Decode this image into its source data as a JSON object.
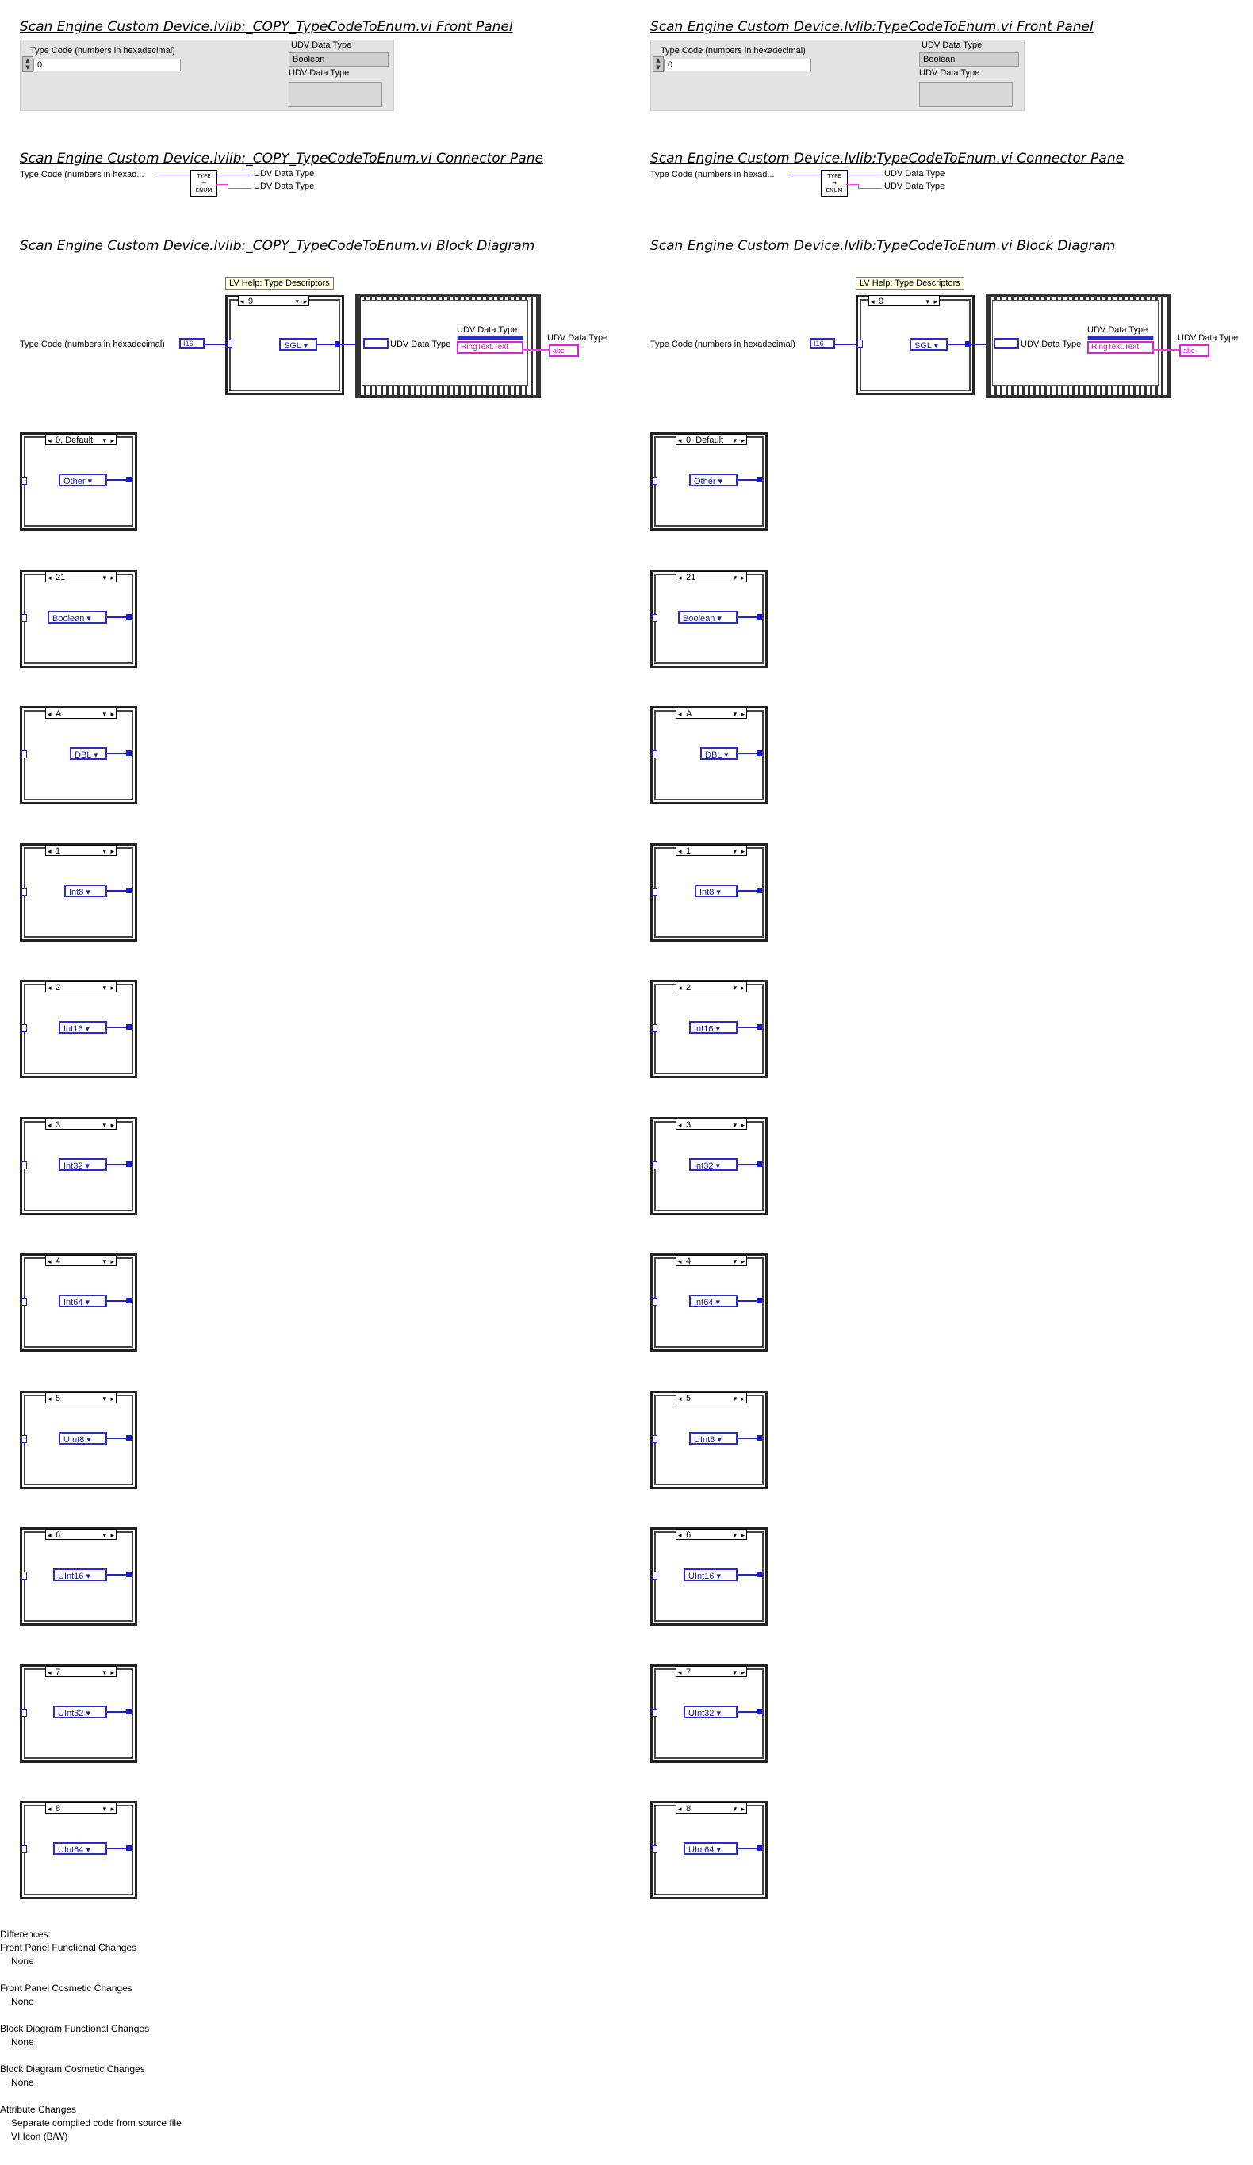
{
  "panels": [
    {
      "fp_title": "Scan Engine Custom Device.lvlib:_COPY_TypeCodeToEnum.vi Front Panel",
      "cp_title": "Scan Engine Custom Device.lvlib:_COPY_TypeCodeToEnum.vi Connector Pane",
      "bd_title": "Scan Engine Custom Device.lvlib:_COPY_TypeCodeToEnum.vi Block Diagram"
    },
    {
      "fp_title": "Scan Engine Custom Device.lvlib:TypeCodeToEnum.vi Front Panel",
      "cp_title": "Scan Engine Custom Device.lvlib:TypeCodeToEnum.vi Connector Pane",
      "bd_title": "Scan Engine Custom Device.lvlib:TypeCodeToEnum.vi Block Diagram"
    }
  ],
  "front_panel": {
    "input_label": "Type Code (numbers in hexadecimal)",
    "input_value": "0",
    "indicator_label": "UDV Data Type",
    "indicator_value": "Boolean",
    "indicator2_label": "UDV Data Type"
  },
  "connector_pane": {
    "input_label": "Type Code (numbers in hexad...",
    "output1": "UDV Data Type",
    "output2": "UDV Data Type",
    "icon_top": "TYPE",
    "icon_mid": "→",
    "icon_bot": "ENUM"
  },
  "block_diagram": {
    "control_label": "Type Code (numbers in hexadecimal)",
    "control_type": "I16",
    "help_bubble": "LV Help: Type Descriptors",
    "main_case_selector": "9",
    "main_enum": "SGL",
    "udv_label_inner": "UDV Data Type",
    "udv_label_prop": "UDV Data Type",
    "prop_node": "RingText.Text",
    "udv_output_label": "UDV Data Type",
    "output_type": "abc",
    "cases": [
      {
        "selector": "0, Default",
        "value": "Other"
      },
      {
        "selector": "21",
        "value": "Boolean"
      },
      {
        "selector": "A",
        "value": "DBL"
      },
      {
        "selector": "1",
        "value": "Int8"
      },
      {
        "selector": "2",
        "value": "Int16"
      },
      {
        "selector": "3",
        "value": "Int32"
      },
      {
        "selector": "4",
        "value": "Int64"
      },
      {
        "selector": "5",
        "value": "UInt8"
      },
      {
        "selector": "6",
        "value": "UInt16"
      },
      {
        "selector": "7",
        "value": "UInt32"
      },
      {
        "selector": "8",
        "value": "UInt64"
      }
    ]
  },
  "differences": {
    "heading": "Differences:",
    "items": [
      {
        "label": "Front Panel Functional Changes",
        "details": [
          "None"
        ]
      },
      {
        "label": "Front Panel Cosmetic Changes",
        "details": [
          "None"
        ]
      },
      {
        "label": "Block Diagram Functional Changes",
        "details": [
          "None"
        ]
      },
      {
        "label": "Block Diagram Cosmetic Changes",
        "details": [
          "None"
        ]
      },
      {
        "label": "Attribute Changes",
        "details": [
          "Separate compiled code from source file",
          "VI Icon (B/W)"
        ]
      }
    ]
  },
  "colors": {
    "wire_numeric": "#2222cc",
    "wire_string": "#ff33ff",
    "help_bubble": "#fffce0"
  }
}
